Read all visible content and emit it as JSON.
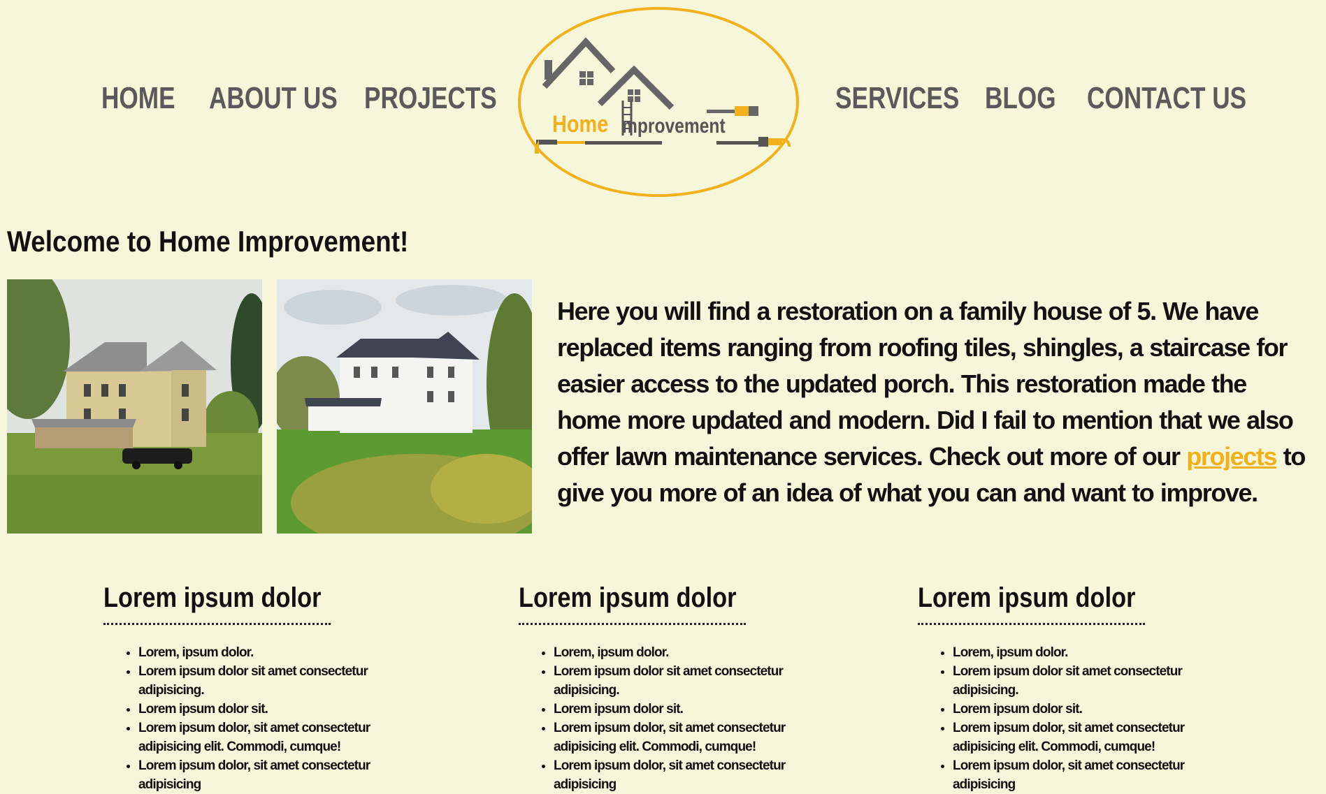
{
  "nav": {
    "home": "HOME",
    "about": "ABOUT US",
    "projects": "PROJECTS",
    "services": "SERVICES",
    "blog": "BLOG",
    "contact": "CONTACT US"
  },
  "logo": {
    "word_home": "Home",
    "word_improvement": "mprovement"
  },
  "colors": {
    "background": "#f6f6db",
    "accent": "#f2b01a",
    "nav_text": "#5a5a5a"
  },
  "welcome": "Welcome to Home Improvement!",
  "intro": {
    "before_link": "Here you will find a restoration on a family house of 5. We have replaced items ranging from roofing tiles, shingles, a staircase for easier access to the updated porch. This restoration made the home more updated and modern. Did I fail to mention that we also offer lawn maintenance services. Check out more of our ",
    "link": "projects",
    "after_link": " to give you more of an idea of what you can and want to improve."
  },
  "columns": [
    {
      "title": "Lorem ipsum dolor",
      "items": [
        "Lorem, ipsum dolor.",
        "Lorem ipsum dolor sit amet consectetur adipisicing.",
        "Lorem ipsum dolor sit.",
        "Lorem ipsum dolor, sit amet consectetur adipisicing elit. Commodi, cumque!",
        "Lorem ipsum dolor, sit amet consectetur adipisicing"
      ]
    },
    {
      "title": "Lorem ipsum dolor",
      "items": [
        "Lorem, ipsum dolor.",
        "Lorem ipsum dolor sit amet consectetur adipisicing.",
        "Lorem ipsum dolor sit.",
        "Lorem ipsum dolor, sit amet consectetur adipisicing elit. Commodi, cumque!",
        "Lorem ipsum dolor, sit amet consectetur adipisicing"
      ]
    },
    {
      "title": "Lorem ipsum dolor",
      "items": [
        "Lorem, ipsum dolor.",
        "Lorem ipsum dolor sit amet consectetur adipisicing.",
        "Lorem ipsum dolor sit.",
        "Lorem ipsum dolor, sit amet consectetur adipisicing elit. Commodi, cumque!",
        "Lorem ipsum dolor, sit amet consectetur adipisicing"
      ]
    }
  ]
}
